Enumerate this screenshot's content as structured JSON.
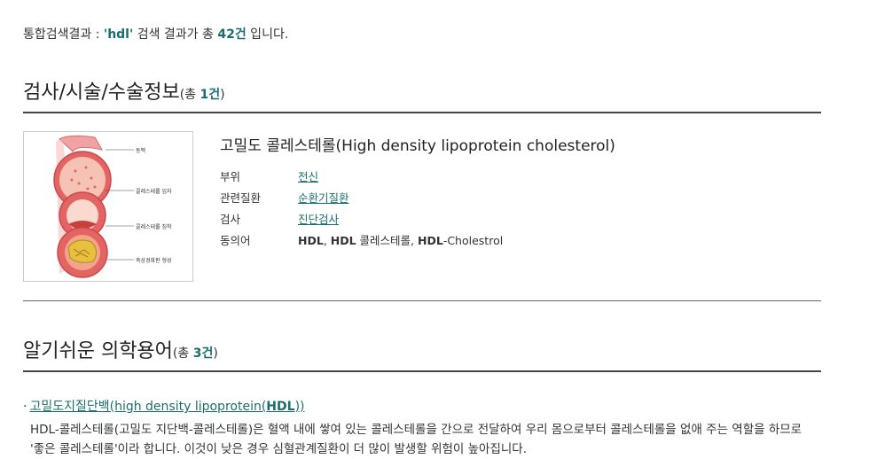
{
  "summary": {
    "prefix": "통합검색결과 : ",
    "query": "'hdl'",
    "middle": " 검색 결과가 총 ",
    "count": "42건",
    "suffix": " 입니다."
  },
  "section1": {
    "title": "검사/시술/수술정보",
    "total_prefix": "(총 ",
    "total_count": "1건",
    "total_suffix": ")"
  },
  "item": {
    "title": "고밀도 콜레스테롤(High density lipoprotein cholesterol)",
    "image_labels": [
      "동맥",
      "콜레스테롤 입자",
      "콜레스테롤 침착",
      "죽상경화판 형성"
    ],
    "rows": {
      "part_label": "부위",
      "part_value": "전신",
      "disease_label": "관련질환",
      "disease_value": "순환기질환",
      "test_label": "검사",
      "test_value": "진단검사",
      "syn_label": "동의어",
      "syn_a": "HDL",
      "syn_b": ", ",
      "syn_c": "HDL",
      "syn_d": " 콜레스테롤, ",
      "syn_e": "HDL",
      "syn_f": "-Cholestrol"
    }
  },
  "section2": {
    "title": "알기쉬운 의학용어",
    "total_prefix": "(총 ",
    "total_count": "3건",
    "total_suffix": ")"
  },
  "term": {
    "bullet": "·",
    "link_pre": "고밀도지질단백(high density lipoprotein(",
    "link_bold": "HDL",
    "link_post": "))",
    "description": "HDL-콜레스테롤(고밀도 지단백-콜레스테롤)은 혈액 내에 쌓여 있는 콜레스테롤을 간으로 전달하여 우리 몸으로부터 콜레스테롤을 없애 주는 역할을 하므로 '좋은 콜레스테롤'이라 합니다. 이것이 낮은 경우 심혈관계질환이 더 많이 발생할 위험이 높아집니다."
  },
  "colors": {
    "accent": "#1a6e6e",
    "vessel": "#e06060",
    "plaque": "#e8c040"
  }
}
